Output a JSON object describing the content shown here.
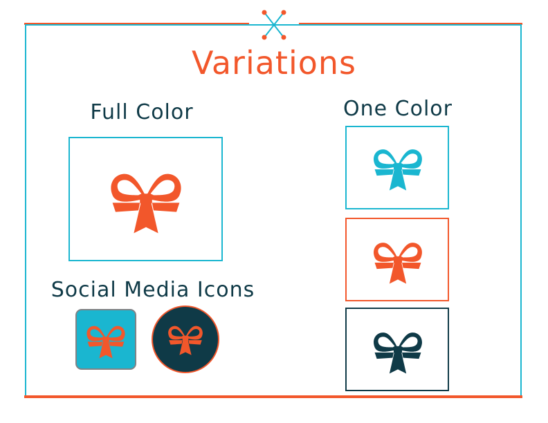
{
  "title": "Variations",
  "sections": {
    "full_color": {
      "heading": "Full Color"
    },
    "one_color": {
      "heading": "One Color"
    },
    "social_media": {
      "heading": "Social Media Icons"
    }
  },
  "colors": {
    "orange": "#f2572b",
    "cyan": "#1ab6d0",
    "dark_teal": "#0f3a47",
    "gray_border": "#808285",
    "white": "#ffffff"
  },
  "icons": {
    "logo": "bow-ribbon-icon",
    "ornament": "crossed-sticks-ornament"
  }
}
